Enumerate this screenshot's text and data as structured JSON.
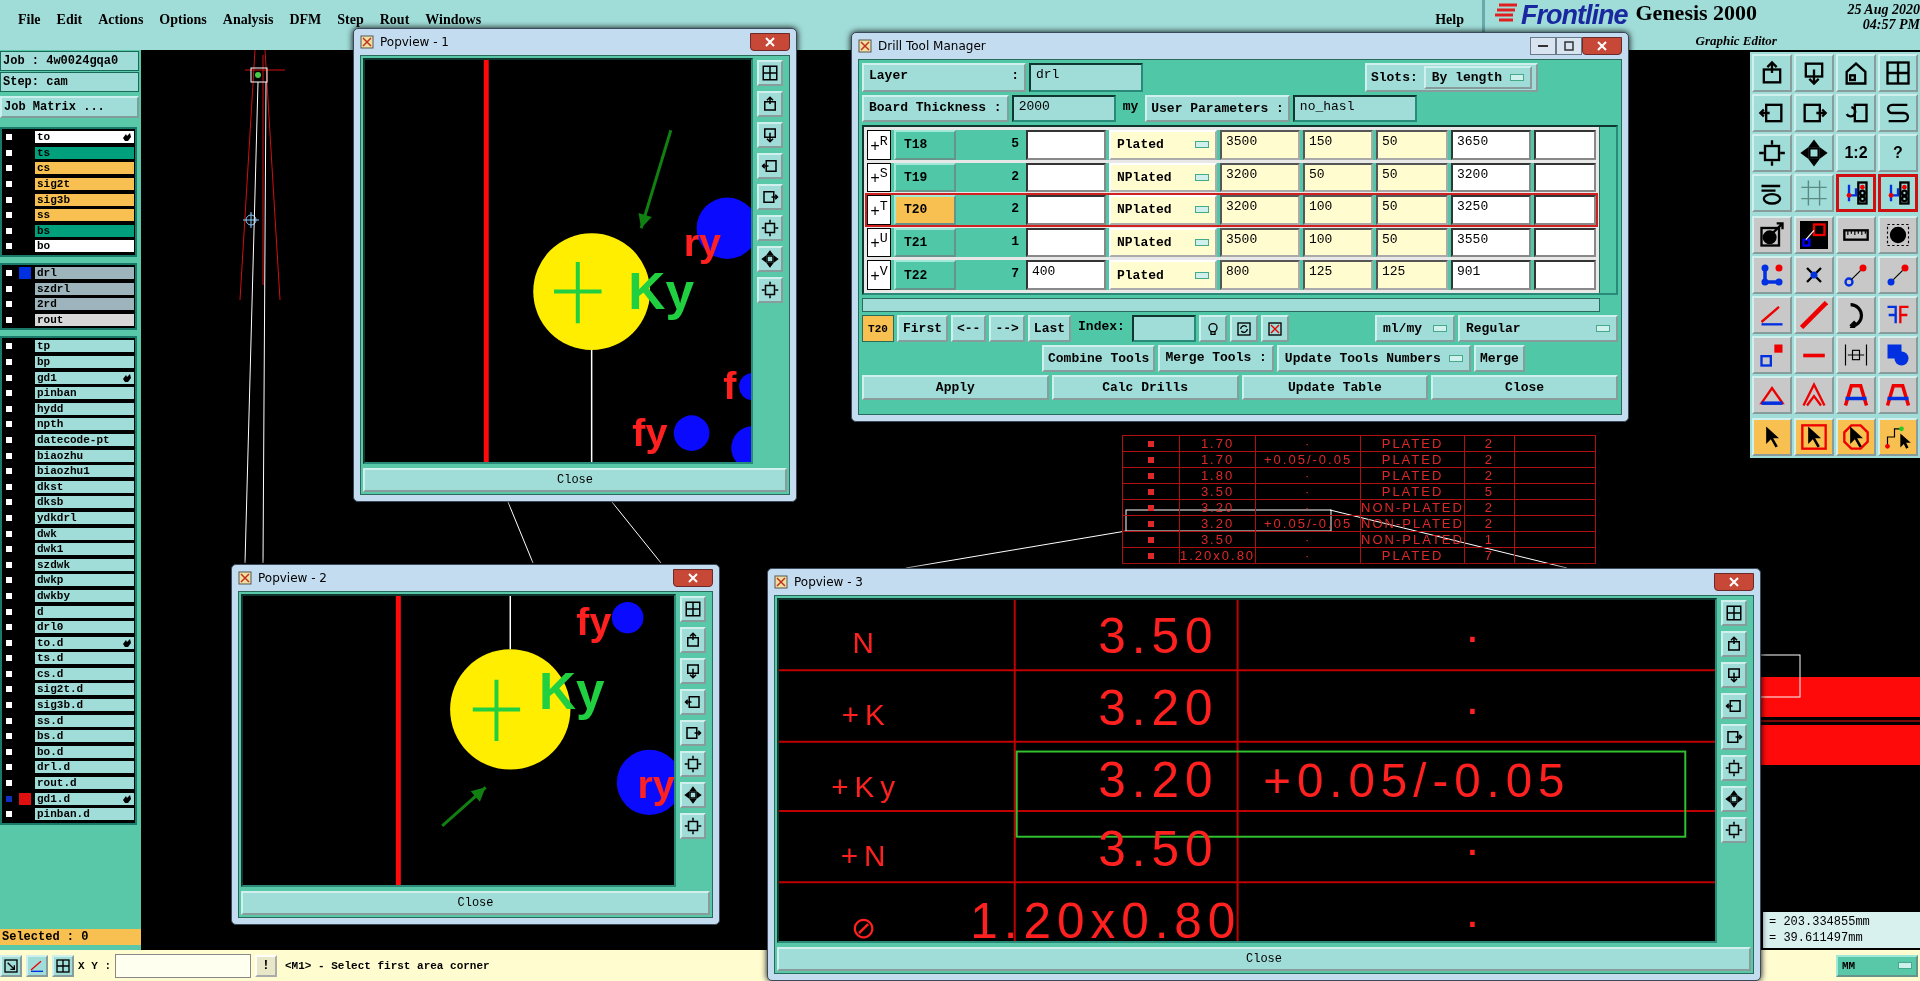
{
  "menu": [
    {
      "label": "File"
    },
    {
      "label": "Edit"
    },
    {
      "label": "Actions"
    },
    {
      "label": "Options"
    },
    {
      "label": "Analysis"
    },
    {
      "label": "DFM"
    },
    {
      "label": "Step"
    },
    {
      "label": "Rout"
    },
    {
      "label": "Windows"
    }
  ],
  "help": "Help",
  "branding": {
    "logo": "Frontline",
    "product": "Genesis 2000",
    "subtitle": "Graphic Editor",
    "date": "25 Aug 2020",
    "time": "04:57 PM"
  },
  "job": {
    "job": "Job : 4w0024gqa0",
    "step": "Step: cam",
    "matrix_button": "Job Matrix ..."
  },
  "layer_groups": [
    {
      "layers": [
        {
          "name": "to",
          "kind": "silk",
          "hand": true,
          "selected": false
        },
        {
          "name": "ts",
          "kind": "mask",
          "selected": false
        },
        {
          "name": "cs",
          "kind": "signal",
          "selected": false
        },
        {
          "name": "sig2t",
          "kind": "signal",
          "selected": false
        },
        {
          "name": "sig3b",
          "kind": "signal",
          "selected": false
        },
        {
          "name": "ss",
          "kind": "signal",
          "selected": false
        },
        {
          "name": "bs",
          "kind": "mask",
          "selected": false
        },
        {
          "name": "bo",
          "kind": "silk",
          "selected": false
        }
      ]
    },
    {
      "layers": [
        {
          "name": "drl",
          "kind": "drill",
          "color": "#0030e0",
          "selected": false
        },
        {
          "name": "szdrl",
          "kind": "drill",
          "selected": false
        },
        {
          "name": "2rd",
          "kind": "drill",
          "selected": false
        },
        {
          "name": "rout",
          "kind": "rout",
          "selected": false
        }
      ]
    },
    {
      "layers": [
        {
          "name": "tp",
          "kind": "misc",
          "selected": false
        },
        {
          "name": "bp",
          "kind": "misc",
          "selected": false
        },
        {
          "name": "gd1",
          "kind": "misc",
          "hand": true,
          "selected": false
        },
        {
          "name": "pinban",
          "kind": "misc",
          "selected": false
        },
        {
          "name": "hydd",
          "kind": "misc",
          "selected": false
        },
        {
          "name": "npth",
          "kind": "misc",
          "selected": false
        },
        {
          "name": "datecode-pt",
          "kind": "misc",
          "selected": false
        },
        {
          "name": "biaozhu",
          "kind": "misc",
          "selected": false
        },
        {
          "name": "biaozhu1",
          "kind": "misc",
          "selected": false
        },
        {
          "name": "dkst",
          "kind": "misc",
          "selected": false
        },
        {
          "name": "dksb",
          "kind": "misc",
          "selected": false
        },
        {
          "name": "ydkdrl",
          "kind": "misc",
          "selected": false
        },
        {
          "name": "dwk",
          "kind": "misc",
          "selected": false
        },
        {
          "name": "dwk1",
          "kind": "misc",
          "selected": false
        },
        {
          "name": "szdwk",
          "kind": "misc",
          "selected": false
        },
        {
          "name": "dwkp",
          "kind": "misc",
          "selected": false
        },
        {
          "name": "dwkby",
          "kind": "misc",
          "selected": false
        },
        {
          "name": "d",
          "kind": "misc",
          "selected": false
        },
        {
          "name": "drl0",
          "kind": "misc",
          "selected": false
        },
        {
          "name": "to.d",
          "kind": "misc",
          "hand": true,
          "selected": false
        },
        {
          "name": "ts.d",
          "kind": "misc",
          "selected": false
        },
        {
          "name": "cs.d",
          "kind": "misc",
          "selected": false
        },
        {
          "name": "sig2t.d",
          "kind": "misc",
          "selected": false
        },
        {
          "name": "sig3b.d",
          "kind": "misc",
          "selected": false
        },
        {
          "name": "ss.d",
          "kind": "misc",
          "selected": false
        },
        {
          "name": "bs.d",
          "kind": "misc",
          "selected": false
        },
        {
          "name": "bo.d",
          "kind": "misc",
          "selected": false
        },
        {
          "name": "drl.d",
          "kind": "misc",
          "selected": false
        },
        {
          "name": "rout.d",
          "kind": "misc",
          "selected": false
        },
        {
          "name": "gd1.d",
          "kind": "misc",
          "hand": true,
          "color": "#e01010",
          "selected": true
        },
        {
          "name": "pinban.d",
          "kind": "misc",
          "selected": false
        }
      ]
    }
  ],
  "selected_count": "Selected : 0",
  "canvas": {
    "table_rows": [
      {
        "size": "1.70",
        "tolerance": "·",
        "type": "PLATED",
        "count": "2"
      },
      {
        "size": "1.70",
        "tolerance": "+0.05/-0.05",
        "type": "PLATED",
        "count": "2"
      },
      {
        "size": "1.80",
        "tolerance": "·",
        "type": "PLATED",
        "count": "2"
      },
      {
        "size": "3.50",
        "tolerance": "·",
        "type": "PLATED",
        "count": "5"
      },
      {
        "size": "3.20",
        "tolerance": "·",
        "type": "NON-PLATED",
        "count": "2"
      },
      {
        "size": "3.20",
        "tolerance": "+0.05/-0.05",
        "type": "NON-PLATED",
        "count": "2"
      },
      {
        "size": "3.50",
        "tolerance": "·",
        "type": "NON-PLATED",
        "count": "1"
      },
      {
        "size": "1.20x0.80",
        "tolerance": "·",
        "type": "PLATED",
        "count": "7"
      }
    ],
    "coordinates": [
      "= 203.334855mm",
      "= 39.611497mm"
    ]
  },
  "toolbar": [
    {
      "kind": "view",
      "buttons": [
        {
          "highlighted": false
        },
        {
          "highlighted": false
        },
        {
          "highlighted": false
        },
        {
          "highlighted": false
        },
        {
          "highlighted": false
        },
        {
          "highlighted": false
        },
        {
          "highlighted": false
        },
        {
          "highlighted": false
        },
        {
          "highlighted": false
        },
        {
          "highlighted": false
        },
        {
          "text": "1:2",
          "highlighted": false
        },
        {
          "text": "?",
          "highlighted": false
        },
        {
          "highlighted": false
        },
        {
          "highlighted": false
        },
        {
          "highlighted": true
        },
        {
          "highlighted": true
        }
      ]
    },
    {
      "kind": "edit",
      "buttons": [
        {
          "highlighted": false
        },
        {
          "highlighted": false
        },
        {
          "highlighted": false
        },
        {
          "highlighted": false
        },
        {
          "highlighted": false
        },
        {
          "highlighted": false
        },
        {
          "highlighted": false
        },
        {
          "highlighted": false
        },
        {
          "highlighted": false
        },
        {
          "highlighted": false
        },
        {
          "highlighted": false
        },
        {
          "highlighted": false
        },
        {
          "highlighted": false
        },
        {
          "highlighted": false
        },
        {
          "highlighted": false
        },
        {
          "highlighted": false
        },
        {
          "highlighted": false
        },
        {
          "highlighted": false
        },
        {
          "highlighted": false
        },
        {
          "highlighted": false
        }
      ]
    },
    {
      "kind": "select",
      "buttons": [
        {
          "highlighted": false
        },
        {
          "highlighted": false
        },
        {
          "highlighted": false
        },
        {
          "highlighted": false
        }
      ]
    }
  ],
  "drill_tool_manager": {
    "title": "Drill Tool Manager",
    "layer_label": "Layer",
    "layer_colon": ":",
    "layer": "drl",
    "slots_label": "Slots:",
    "slots": "By length",
    "thickness_label": "Board Thickness :",
    "thickness": "2000",
    "thickness_unit": "my",
    "user_params_button": "User Parameters :",
    "user_params": "no_hasl",
    "rows": [
      {
        "symbol": "+$^{R}$",
        "tool": "T18",
        "count": "5",
        "type": "Plated",
        "column_5": "3500",
        "column_6": "150",
        "column_7": "50",
        "column_8": "3650",
        "selected": false
      },
      {
        "symbol": "+$^{S}$",
        "tool": "T19",
        "count": "2",
        "type": "NPlated",
        "column_5": "3200",
        "column_6": "50",
        "column_7": "50",
        "column_8": "3200",
        "selected": false
      },
      {
        "symbol": "+$^{T}$",
        "tool": "T20",
        "count": "2",
        "type": "NPlated",
        "column_5": "3200",
        "column_6": "100",
        "column_7": "50",
        "column_8": "3250",
        "selected": true
      },
      {
        "symbol": "+$^{U}$",
        "tool": "T21",
        "count": "1",
        "type": "NPlated",
        "column_5": "3500",
        "column_6": "100",
        "column_7": "50",
        "column_8": "3550",
        "selected": false
      },
      {
        "symbol": "+$^{V}$",
        "tool": "T22",
        "count": "7",
        "column_3": "400",
        "type": "Plated",
        "column_5": "800",
        "column_6": "125",
        "column_7": "125",
        "column_8": "901",
        "selected": false
      }
    ],
    "current_tool": "T20",
    "nav_buttons": [
      "First",
      "<--",
      "-->",
      "Last"
    ],
    "index_label": "Index:",
    "units": "ml/my",
    "mode": "Regular",
    "combine_button": "Combine Tools",
    "merge_label": "Merge Tools :",
    "merge_mode": "Update Tools Numbers",
    "merge_button": "Merge",
    "actions": [
      "Apply",
      "Calc Drills",
      "Update Table",
      "Close"
    ]
  },
  "popviews": [
    {
      "kind": "pads",
      "title": "Popview - 1",
      "close": "Close",
      "labels": [
        {
          "text": "Ky",
          "color": "#20d040"
        },
        {
          "text": "ry",
          "color": "#ff2020"
        },
        {
          "text": "fy",
          "color": "#ff2020"
        },
        {
          "text": "f",
          "color": "#ff2020"
        }
      ]
    },
    {
      "kind": "pads",
      "title": "Popview - 2",
      "close": "Close",
      "labels": [
        {
          "text": "Ky",
          "color": "#20d040"
        },
        {
          "text": "fy",
          "color": "#ff2020"
        },
        {
          "text": "ry",
          "color": "#ff2020"
        }
      ]
    },
    {
      "kind": "table",
      "title": "Popview - 3",
      "close": "Close",
      "rows": [
        {
          "symbol": "N",
          "size": "3.50",
          "tolerance": "·",
          "selected": false
        },
        {
          "symbol": "+K",
          "size": "3.20",
          "tolerance": "·",
          "selected": false
        },
        {
          "symbol": "+Ky",
          "size": "3.20",
          "tolerance": "+0.05/-0.05",
          "selected": true
        },
        {
          "symbol": "+N",
          "size": "3.50",
          "tolerance": "·",
          "selected": false
        },
        {
          "symbol": "⊘",
          "size": "1.20x0.80",
          "tolerance": "·",
          "selected": false
        }
      ]
    }
  ],
  "status_bar": {
    "xy_label": "X Y :",
    "alert_button": "!",
    "message": "<M1> - Select first area corner",
    "units": "MM"
  }
}
